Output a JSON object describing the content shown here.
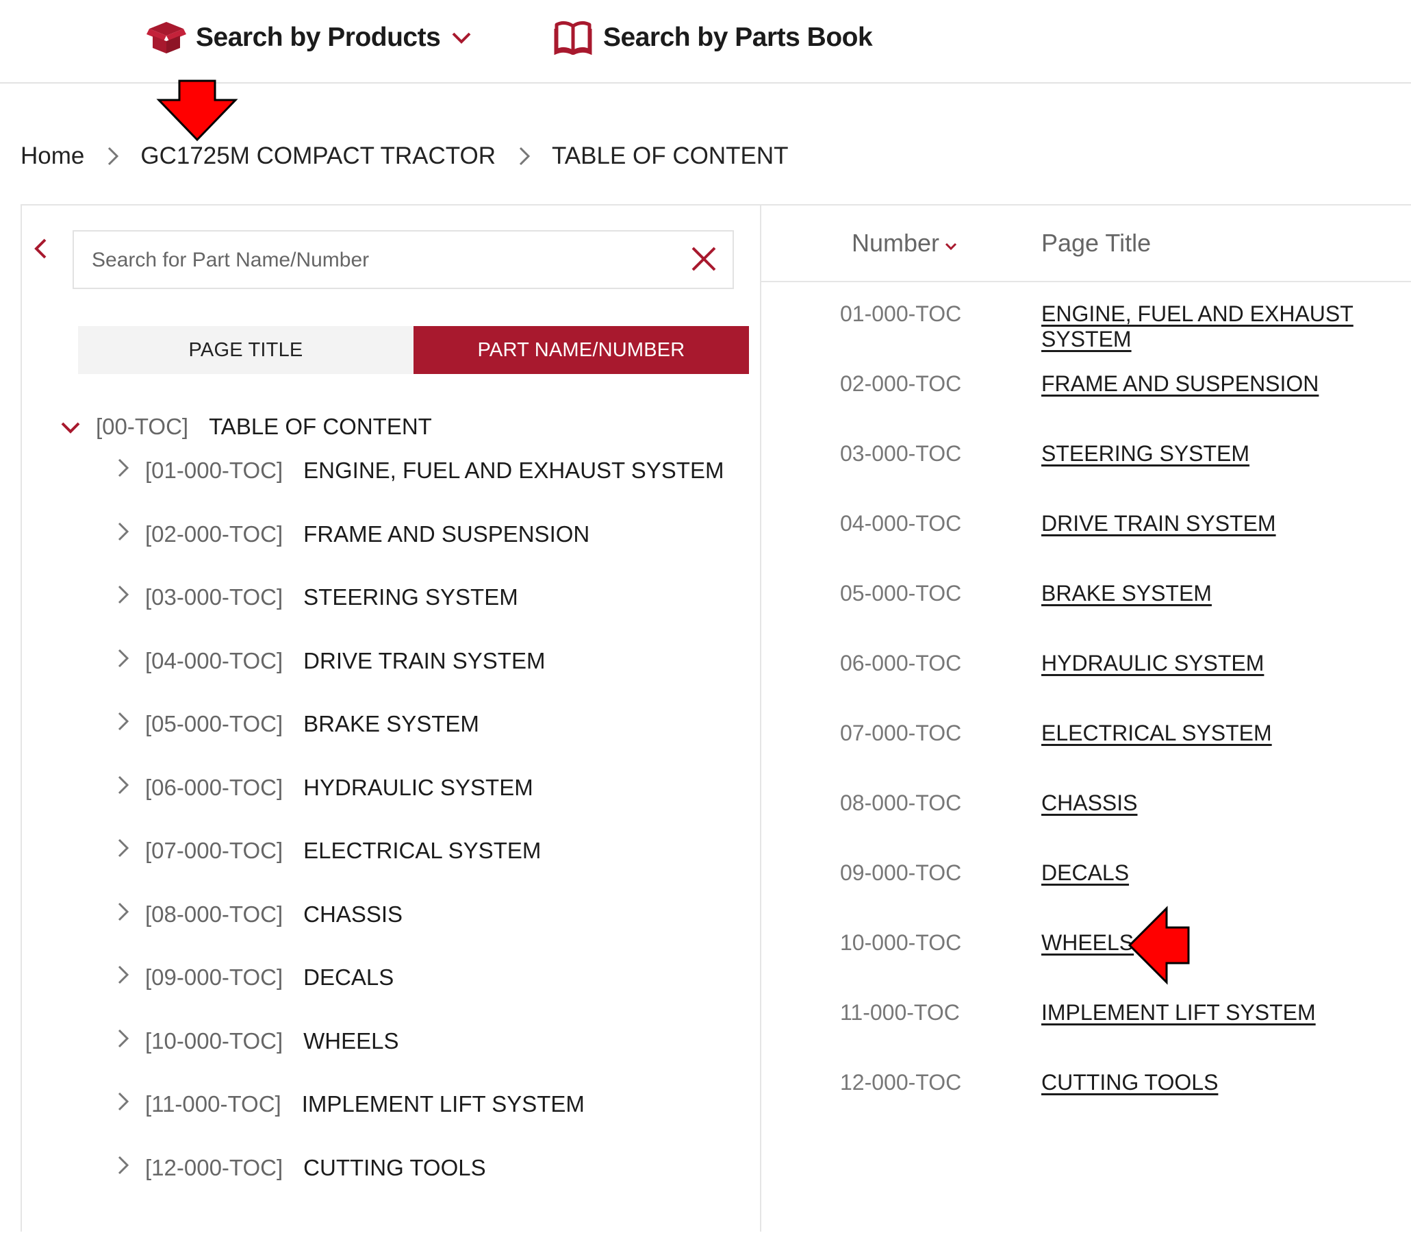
{
  "nav": {
    "products_label": "Search by Products",
    "parts_book_label": "Search by Parts Book"
  },
  "breadcrumb": {
    "home": "Home",
    "product": "GC1725M COMPACT TRACTOR",
    "current": "TABLE OF CONTENT"
  },
  "search": {
    "placeholder": "Search for Part Name/Number",
    "value": ""
  },
  "toggle": {
    "page_title": "PAGE TITLE",
    "part_name_number": "PART NAME/NUMBER",
    "active": "part_name_number"
  },
  "tree": {
    "root": {
      "code": "[00-TOC]",
      "title": "TABLE OF CONTENT"
    },
    "children": [
      {
        "code": "[01-000-TOC]",
        "title": "ENGINE, FUEL AND EXHAUST SYSTEM"
      },
      {
        "code": "[02-000-TOC]",
        "title": "FRAME AND SUSPENSION"
      },
      {
        "code": "[03-000-TOC]",
        "title": "STEERING SYSTEM"
      },
      {
        "code": "[04-000-TOC]",
        "title": "DRIVE TRAIN SYSTEM"
      },
      {
        "code": "[05-000-TOC]",
        "title": "BRAKE SYSTEM"
      },
      {
        "code": "[06-000-TOC]",
        "title": "HYDRAULIC SYSTEM"
      },
      {
        "code": "[07-000-TOC]",
        "title": "ELECTRICAL SYSTEM"
      },
      {
        "code": "[08-000-TOC]",
        "title": "CHASSIS"
      },
      {
        "code": "[09-000-TOC]",
        "title": "DECALS"
      },
      {
        "code": "[10-000-TOC]",
        "title": "WHEELS"
      },
      {
        "code": "[11-000-TOC]",
        "title": "IMPLEMENT LIFT SYSTEM"
      },
      {
        "code": "[12-000-TOC]",
        "title": "CUTTING TOOLS"
      }
    ]
  },
  "table": {
    "header_number": "Number",
    "header_title": "Page Title",
    "rows": [
      {
        "number": "01-000-TOC",
        "title": "ENGINE, FUEL AND EXHAUST SYSTEM"
      },
      {
        "number": "02-000-TOC",
        "title": "FRAME AND SUSPENSION"
      },
      {
        "number": "03-000-TOC",
        "title": "STEERING SYSTEM"
      },
      {
        "number": "04-000-TOC",
        "title": "DRIVE TRAIN SYSTEM"
      },
      {
        "number": "05-000-TOC",
        "title": "BRAKE SYSTEM"
      },
      {
        "number": "06-000-TOC",
        "title": "HYDRAULIC SYSTEM"
      },
      {
        "number": "07-000-TOC",
        "title": "ELECTRICAL SYSTEM"
      },
      {
        "number": "08-000-TOC",
        "title": "CHASSIS"
      },
      {
        "number": "09-000-TOC",
        "title": "DECALS"
      },
      {
        "number": "10-000-TOC",
        "title": "WHEELS"
      },
      {
        "number": "11-000-TOC",
        "title": "IMPLEMENT LIFT SYSTEM"
      },
      {
        "number": "12-000-TOC",
        "title": "CUTTING TOOLS"
      }
    ]
  },
  "icons": {
    "products": "box-icon",
    "parts_book": "book-icon",
    "products_dropdown": "chevron-down-icon",
    "breadcrumb_separator": "chevron-right-icon",
    "back": "chevron-left-icon",
    "clear": "close-icon",
    "tree_expanded": "chevron-down-icon",
    "tree_collapsed": "chevron-right-icon",
    "sort": "sort-down-icon",
    "annotation": "red-arrow-icon"
  },
  "colors": {
    "brand": "#a8192e",
    "annotation_arrow": "#ff0000"
  }
}
